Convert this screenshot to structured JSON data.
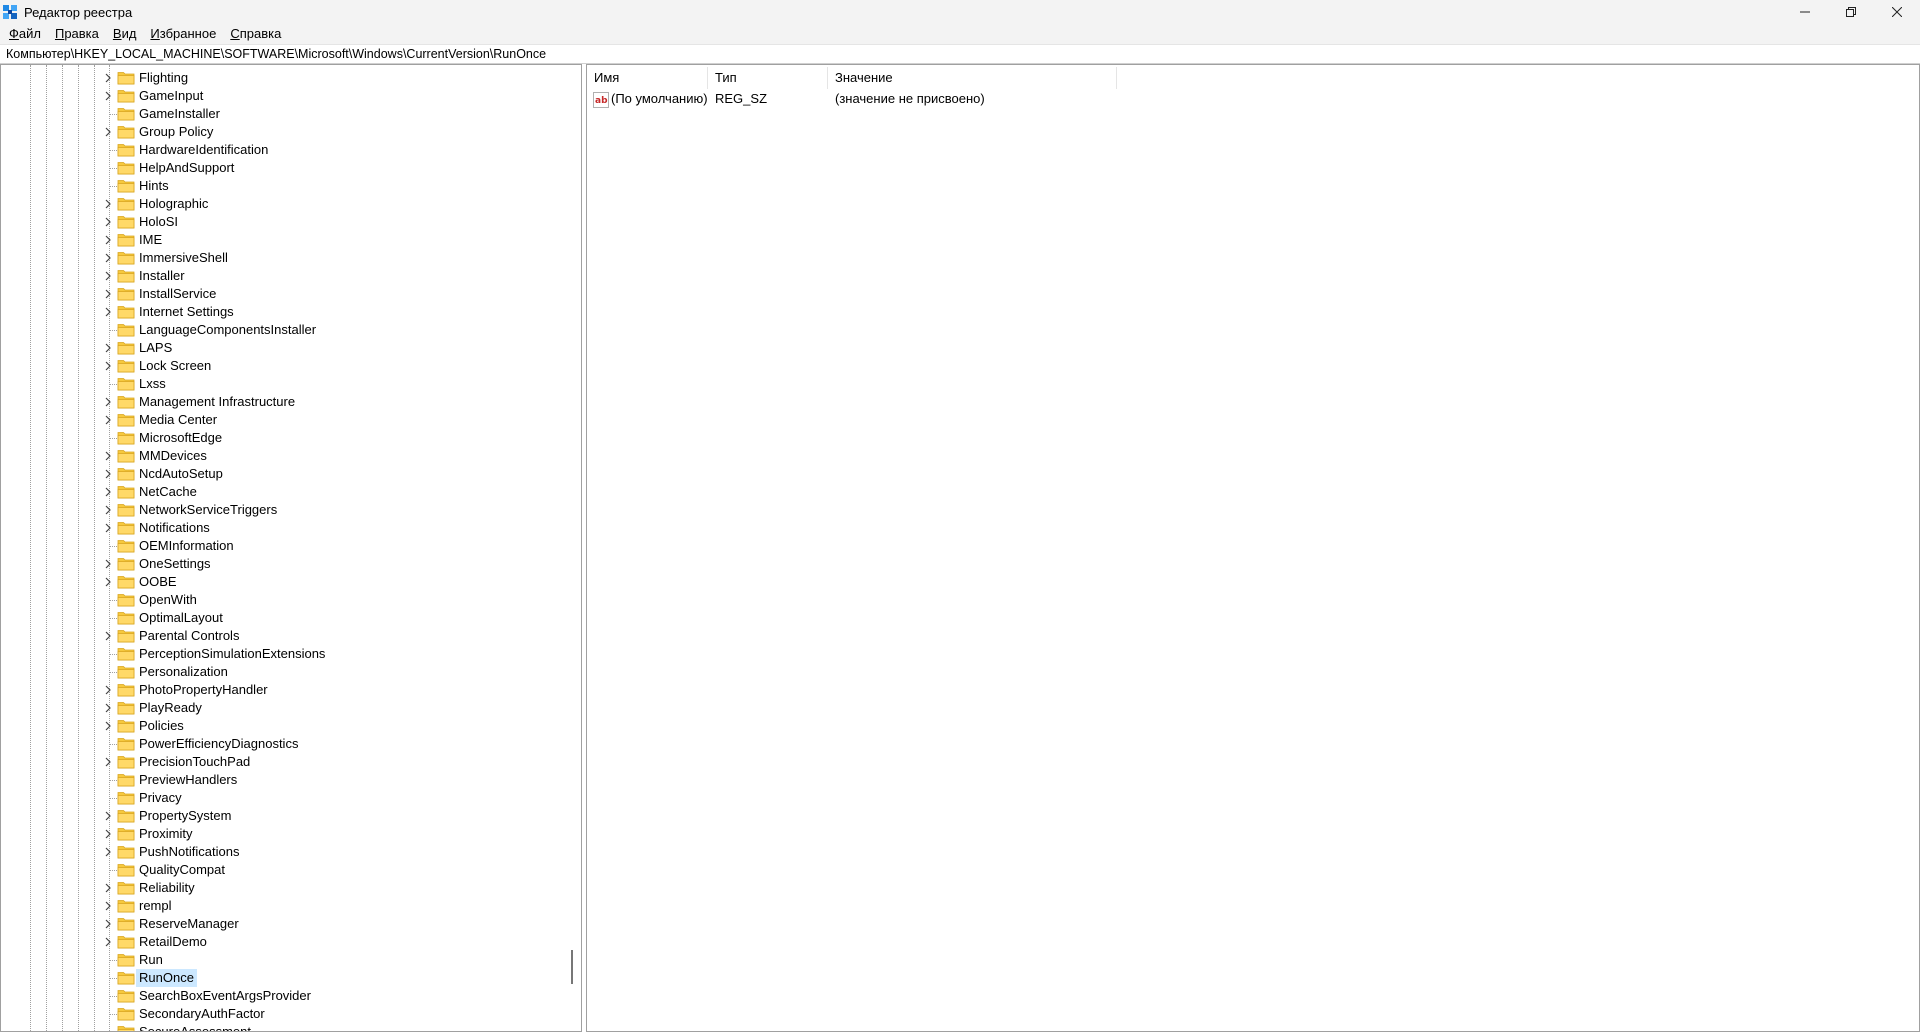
{
  "window": {
    "title": "Редактор реестра",
    "minimize_icon": "minimize-icon",
    "restore_icon": "restore-icon",
    "close_icon": "close-icon"
  },
  "menu": {
    "items": [
      {
        "accel": "Ф",
        "rest": "айл"
      },
      {
        "accel": "П",
        "rest": "равка"
      },
      {
        "accel": "В",
        "rest": "ид"
      },
      {
        "accel": "И",
        "rest": "збранное"
      },
      {
        "accel": "С",
        "rest": "правка"
      }
    ]
  },
  "address": {
    "path": "Компьютер\\HKEY_LOCAL_MACHINE\\SOFTWARE\\Microsoft\\Windows\\CurrentVersion\\RunOnce"
  },
  "tree": {
    "items": [
      {
        "label": "Flighting",
        "expandable": true
      },
      {
        "label": "GameInput",
        "expandable": true
      },
      {
        "label": "GameInstaller",
        "expandable": false
      },
      {
        "label": "Group Policy",
        "expandable": true
      },
      {
        "label": "HardwareIdentification",
        "expandable": false
      },
      {
        "label": "HelpAndSupport",
        "expandable": false
      },
      {
        "label": "Hints",
        "expandable": false
      },
      {
        "label": "Holographic",
        "expandable": true
      },
      {
        "label": "HoloSI",
        "expandable": true
      },
      {
        "label": "IME",
        "expandable": true
      },
      {
        "label": "ImmersiveShell",
        "expandable": true
      },
      {
        "label": "Installer",
        "expandable": true
      },
      {
        "label": "InstallService",
        "expandable": true
      },
      {
        "label": "Internet Settings",
        "expandable": true
      },
      {
        "label": "LanguageComponentsInstaller",
        "expandable": false
      },
      {
        "label": "LAPS",
        "expandable": true
      },
      {
        "label": "Lock Screen",
        "expandable": true
      },
      {
        "label": "Lxss",
        "expandable": false
      },
      {
        "label": "Management Infrastructure",
        "expandable": true
      },
      {
        "label": "Media Center",
        "expandable": true
      },
      {
        "label": "MicrosoftEdge",
        "expandable": false
      },
      {
        "label": "MMDevices",
        "expandable": true
      },
      {
        "label": "NcdAutoSetup",
        "expandable": true
      },
      {
        "label": "NetCache",
        "expandable": true
      },
      {
        "label": "NetworkServiceTriggers",
        "expandable": true
      },
      {
        "label": "Notifications",
        "expandable": true
      },
      {
        "label": "OEMInformation",
        "expandable": false
      },
      {
        "label": "OneSettings",
        "expandable": true
      },
      {
        "label": "OOBE",
        "expandable": true
      },
      {
        "label": "OpenWith",
        "expandable": false
      },
      {
        "label": "OptimalLayout",
        "expandable": false
      },
      {
        "label": "Parental Controls",
        "expandable": true
      },
      {
        "label": "PerceptionSimulationExtensions",
        "expandable": false
      },
      {
        "label": "Personalization",
        "expandable": false
      },
      {
        "label": "PhotoPropertyHandler",
        "expandable": true
      },
      {
        "label": "PlayReady",
        "expandable": true
      },
      {
        "label": "Policies",
        "expandable": true
      },
      {
        "label": "PowerEfficiencyDiagnostics",
        "expandable": false
      },
      {
        "label": "PrecisionTouchPad",
        "expandable": true
      },
      {
        "label": "PreviewHandlers",
        "expandable": false
      },
      {
        "label": "Privacy",
        "expandable": false
      },
      {
        "label": "PropertySystem",
        "expandable": true
      },
      {
        "label": "Proximity",
        "expandable": true
      },
      {
        "label": "PushNotifications",
        "expandable": true
      },
      {
        "label": "QualityCompat",
        "expandable": false
      },
      {
        "label": "Reliability",
        "expandable": true
      },
      {
        "label": "rempl",
        "expandable": true
      },
      {
        "label": "ReserveManager",
        "expandable": true
      },
      {
        "label": "RetailDemo",
        "expandable": true
      },
      {
        "label": "Run",
        "expandable": false
      },
      {
        "label": "RunOnce",
        "expandable": false,
        "selected": true
      },
      {
        "label": "SearchBoxEventArgsProvider",
        "expandable": false
      },
      {
        "label": "SecondaryAuthFactor",
        "expandable": false
      },
      {
        "label": "SecureAssessment",
        "expandable": false
      }
    ]
  },
  "values": {
    "columns": [
      "Имя",
      "Тип",
      "Значение"
    ],
    "rows": [
      {
        "name": "(По умолчанию)",
        "type": "REG_SZ",
        "data": "(значение не присвоено)",
        "icon": "string-value-icon"
      }
    ]
  },
  "colors": {
    "folder": "#f6c93e",
    "selection": "#cce8ff",
    "chrome": "#f3f3f3"
  }
}
